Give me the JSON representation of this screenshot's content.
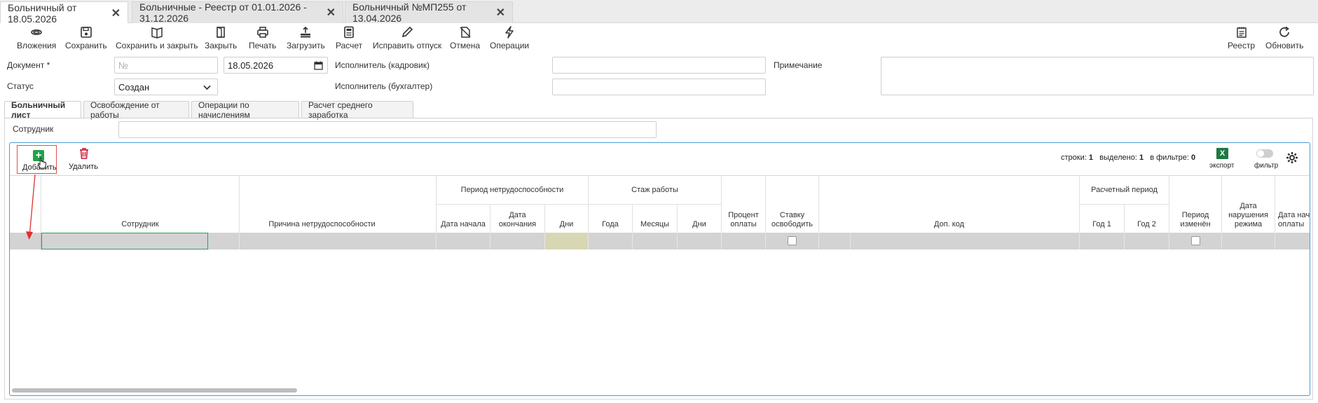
{
  "tabs": [
    {
      "label": "Больничный от 18.05.2026"
    },
    {
      "label": "Больничные - Реестр от 01.01.2026 - 31.12.2026"
    },
    {
      "label": "Больничный №МП255 от 13.04.2026"
    }
  ],
  "toolbar": {
    "attachments": "Вложения",
    "save": "Сохранить",
    "save_close": "Сохранить и закрыть",
    "close": "Закрыть",
    "print": "Печать",
    "load": "Загрузить",
    "calc": "Расчет",
    "fix_vacation": "Исправить отпуск",
    "cancel": "Отмена",
    "operations": "Операции",
    "registry": "Реестр",
    "refresh": "Обновить"
  },
  "form": {
    "document_label": "Документ *",
    "number_placeholder": "№",
    "date_value": "18.05.2026",
    "status_label": "Статус",
    "status_value": "Создан",
    "executor_hr_label": "Исполнитель (кадровик)",
    "executor_acc_label": "Исполнитель (бухгалтер)",
    "note_label": "Примечание",
    "employee_label": "Сотрудник"
  },
  "inner_tabs": [
    {
      "label": "Больничный лист"
    },
    {
      "label": "Освобождение от работы"
    },
    {
      "label": "Операции по начислениям"
    },
    {
      "label": "Расчет среднего заработка"
    }
  ],
  "grid": {
    "add": "Добавить",
    "delete": "Удалить",
    "rows_label": "строки:",
    "rows_value": "1",
    "selected_label": "выделено:",
    "selected_value": "1",
    "filter_count_label": "в фильтре:",
    "filter_count_value": "0",
    "export": "экспорт",
    "filter": "фильтр",
    "headers": {
      "employee": "Сотрудник",
      "reason": "Причина нетрудоспособности",
      "period_group": "Период нетрудоспособности",
      "start": "Дата начала",
      "end_l1": "Дата",
      "end_l2": "окончания",
      "days": "Дни",
      "exp_group": "Стаж работы",
      "years": "Года",
      "months": "Месяцы",
      "exp_days": "Дни",
      "pct_l1": "Процент",
      "pct_l2": "оплаты",
      "rate_l1": "Ставку",
      "rate_l2": "освободить",
      "dop_code": "Доп. код",
      "calc_group": "Расчетный период",
      "year1": "Год 1",
      "year2": "Год 2",
      "changed_l1": "Период",
      "changed_l2": "изменён",
      "violation_l1": "Дата",
      "violation_l2": "нарушения",
      "violation_l3": "режима",
      "paystart_l1": "Дата начала",
      "paystart_l2": "оплаты"
    }
  },
  "colors": {
    "accent": "#4a9bd6",
    "excel": "#1d7a43",
    "add": "#1fa34a",
    "delete": "#c8102e"
  }
}
